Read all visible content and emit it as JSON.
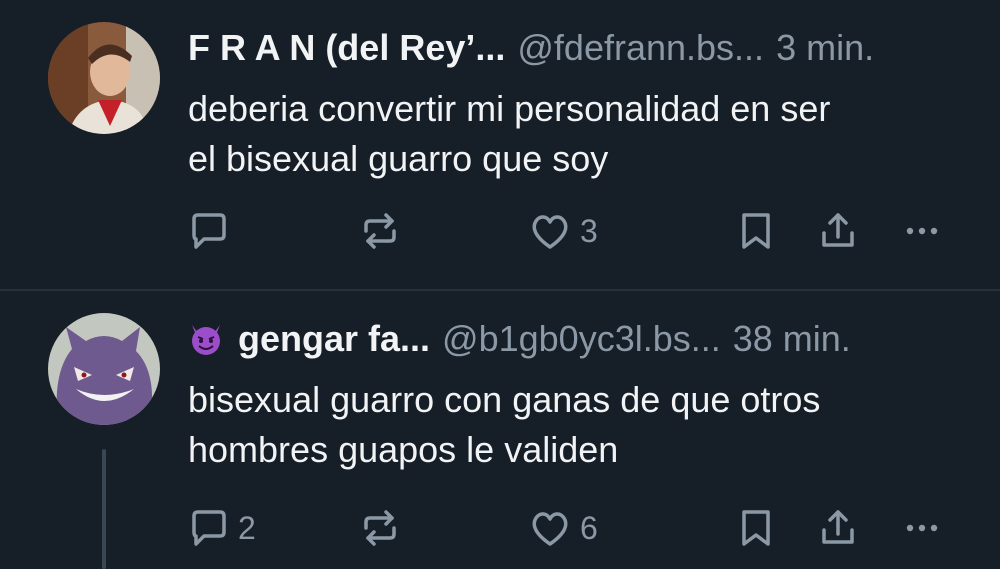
{
  "posts": [
    {
      "display_name": "F R A N (del Rey’...",
      "handle": "@fdefrann.bs...",
      "time": "3 min.",
      "text_line1": "deberia convertir mi personalidad en ser",
      "text_line2": "el bisexual guarro que soy",
      "reply_count": "",
      "repost_count": "",
      "like_count": "3",
      "avatar": "profile-photo-man"
    },
    {
      "display_name": "gengar fa...",
      "handle": "@b1gb0yc3l.bs...",
      "time": "38 min.",
      "text_line1": "bisexual guarro con ganas de que otros",
      "text_line2": "hombres guapos le validen",
      "reply_count": "2",
      "repost_count": "",
      "like_count": "6",
      "avatar": "gengar-avatar",
      "name_emoji": "smiling-devil-emoji"
    }
  ],
  "colors": {
    "background": "#161e27",
    "text": "#f1f3f5",
    "muted": "#8b98a5",
    "divider": "#26313d"
  }
}
